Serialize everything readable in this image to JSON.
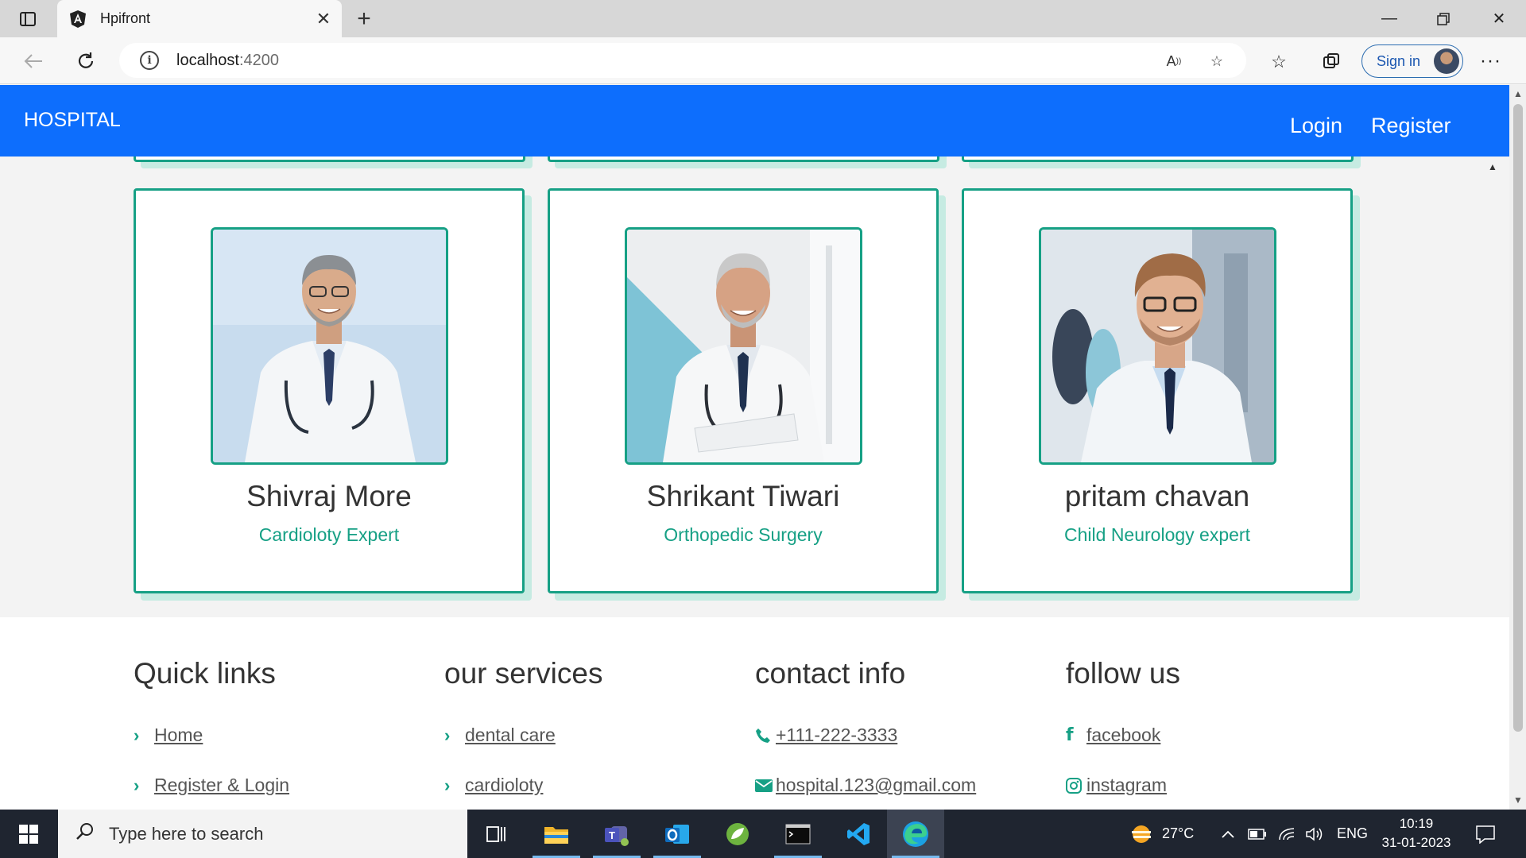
{
  "browser": {
    "tab_title": "Hpifront",
    "url_host": "localhost",
    "url_port": ":4200",
    "signin_label": "Sign in"
  },
  "header": {
    "brand": "HOSPITAL",
    "nav": [
      {
        "label": "Login"
      },
      {
        "label": "Register"
      }
    ]
  },
  "doctors": [
    {
      "name": "Shivraj More",
      "specialty": "Cardioloty Expert"
    },
    {
      "name": "Shrikant Tiwari",
      "specialty": "Orthopedic Surgery"
    },
    {
      "name": "pritam chavan",
      "specialty": "Child Neurology expert"
    }
  ],
  "footer": {
    "columns": [
      {
        "title": "Quick links",
        "links": [
          {
            "icon": "chevron-right-icon",
            "label": "Home"
          },
          {
            "icon": "chevron-right-icon",
            "label": "Register & Login"
          }
        ]
      },
      {
        "title": "our services",
        "links": [
          {
            "icon": "chevron-right-icon",
            "label": "dental care"
          },
          {
            "icon": "chevron-right-icon",
            "label": "cardioloty"
          }
        ]
      },
      {
        "title": "contact info",
        "links": [
          {
            "icon": "phone-icon",
            "label": "+111-222-3333"
          },
          {
            "icon": "envelope-icon",
            "label": "hospital.123@gmail.com"
          }
        ]
      },
      {
        "title": "follow us",
        "links": [
          {
            "icon": "facebook-icon",
            "label": "facebook"
          },
          {
            "icon": "instagram-icon",
            "label": "instagram"
          }
        ]
      }
    ]
  },
  "taskbar": {
    "search_placeholder": "Type here to search",
    "weather": "27°C",
    "language": "ENG",
    "time": "10:19",
    "date": "31-01-2023"
  },
  "colors": {
    "header": "#0d6efd",
    "accent": "#16a085",
    "card_shadow": "#c6ebe2"
  }
}
